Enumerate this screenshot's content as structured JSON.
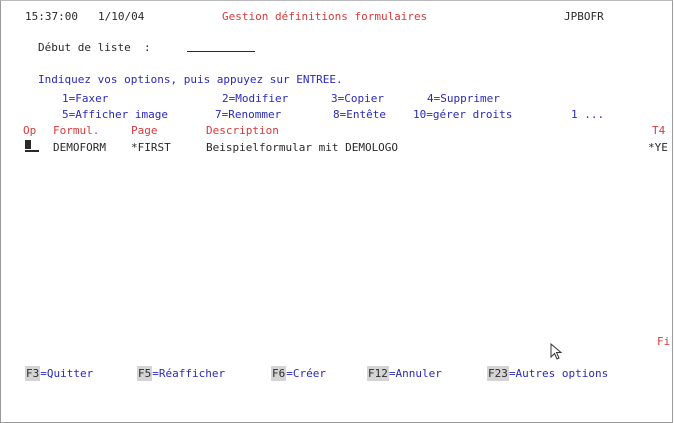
{
  "header": {
    "time": "15:37:00",
    "date": "1/10/04",
    "title": "Gestion définitions formulaires",
    "program": "JPBOFR"
  },
  "position": {
    "label": "Début de liste  :",
    "value": ""
  },
  "instructions": "Indiquez vos options, puis appuyez sur ENTREE.",
  "options_line1": [
    "1=Faxer",
    "2=Modifier",
    "3=Copier",
    "4=Supprimer"
  ],
  "options_line2": [
    "5=Afficher image",
    "7=Renommer",
    "8=Entête",
    "10=gérer droits",
    "1 ..."
  ],
  "columns": {
    "op": "Op",
    "form": "Formul.",
    "page": "Page",
    "description": "Description",
    "t4": "T4"
  },
  "rows": [
    {
      "form": "DEMOFORM",
      "page": "*FIRST",
      "description": "Beispielformular mit DEMOLOGO",
      "t4": "*YE"
    }
  ],
  "end_marker": "Fi",
  "function_keys": [
    {
      "key": "F3",
      "label": "=Quitter"
    },
    {
      "key": "F5",
      "label": "=Réafficher"
    },
    {
      "key": "F6",
      "label": "=Créer"
    },
    {
      "key": "F12",
      "label": "=Annuler"
    },
    {
      "key": "F23",
      "label": "=Autres options"
    }
  ],
  "icons": {
    "mouse_pointer": "mouse-pointer-icon"
  }
}
